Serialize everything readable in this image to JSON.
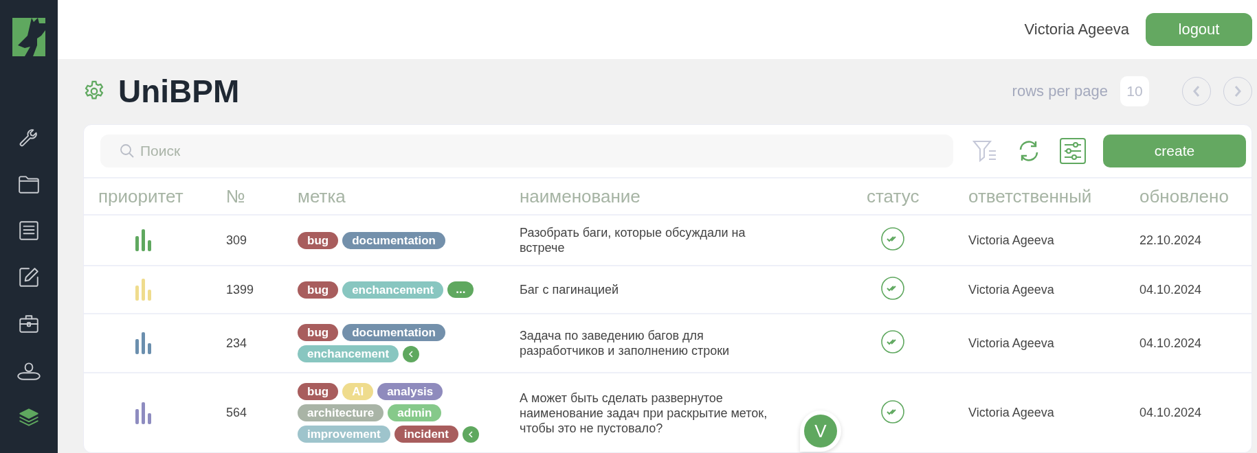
{
  "sidebar": {
    "items": [
      {
        "selected": false
      },
      {
        "selected": false
      },
      {
        "selected": false
      },
      {
        "selected": false
      },
      {
        "selected": false
      },
      {
        "selected": false
      },
      {
        "selected": true
      }
    ]
  },
  "topbar": {
    "user": "Victoria Ageeva",
    "logout": "logout"
  },
  "page": {
    "title": "UniBPM",
    "rows_per_page_label": "rows per page",
    "rows_per_page": "10"
  },
  "toolbar": {
    "search_placeholder": "Поиск",
    "create": "create"
  },
  "table": {
    "columns": [
      "приоритет",
      "№",
      "метка",
      "наименование",
      "статус",
      "ответственный",
      "обновлено"
    ],
    "rows": [
      {
        "priority": {
          "color": "#5fa85f"
        },
        "number": "309",
        "tags": [
          {
            "label": "bug",
            "color": "#a85d5d"
          },
          {
            "label": "documentation",
            "color": "#7390ab"
          }
        ],
        "name": "Разобрать баги, которые обсуждали на встрече",
        "status": {
          "kind": "done"
        },
        "assignee": "Victoria Ageeva",
        "updated": "22.10.2024"
      },
      {
        "priority": {
          "color": "#efdc8d"
        },
        "number": "1399",
        "tags": [
          {
            "label": "bug",
            "color": "#a85d5d"
          },
          {
            "label": "enchancement",
            "color": "#88c6c0"
          }
        ],
        "tags_toggle": {
          "kind": "more",
          "label": "..."
        },
        "name": "Баг с пагинацией",
        "status": {
          "kind": "done"
        },
        "assignee": "Victoria Ageeva",
        "updated": "04.10.2024"
      },
      {
        "priority": {
          "color": "#6b8fae"
        },
        "number": "234",
        "tags": [
          {
            "label": "bug",
            "color": "#a85d5d"
          },
          {
            "label": "documentation",
            "color": "#7390ab"
          },
          {
            "label": "enchancement",
            "color": "#88c6c0"
          }
        ],
        "tags_toggle": {
          "kind": "collapse"
        },
        "name": "Задача по заведению багов для разработчиков и заполнению строки",
        "status": {
          "kind": "done"
        },
        "assignee": "Victoria Ageeva",
        "updated": "04.10.2024"
      },
      {
        "priority": {
          "color": "#8e8cc0"
        },
        "number": "564",
        "tags": [
          {
            "label": "bug",
            "color": "#a85d5d"
          },
          {
            "label": "AI",
            "color": "#efdc8d"
          },
          {
            "label": "analysis",
            "color": "#8f8bbd"
          },
          {
            "label": "architecture",
            "color": "#a9b4a6"
          },
          {
            "label": "admin",
            "color": "#86c98a"
          },
          {
            "label": "improvement",
            "color": "#9ec4cc"
          },
          {
            "label": "incident",
            "color": "#a85d5d"
          }
        ],
        "tags_toggle": {
          "kind": "collapse"
        },
        "name": "А может быть сделать развернутое наименование задач при раскрытие меток, чтобы это не пустовало?",
        "status": {
          "kind": "done"
        },
        "assignee": "Victoria Ageeva",
        "updated": "04.10.2024"
      }
    ]
  },
  "chat_bubble": {
    "initial": "V"
  }
}
